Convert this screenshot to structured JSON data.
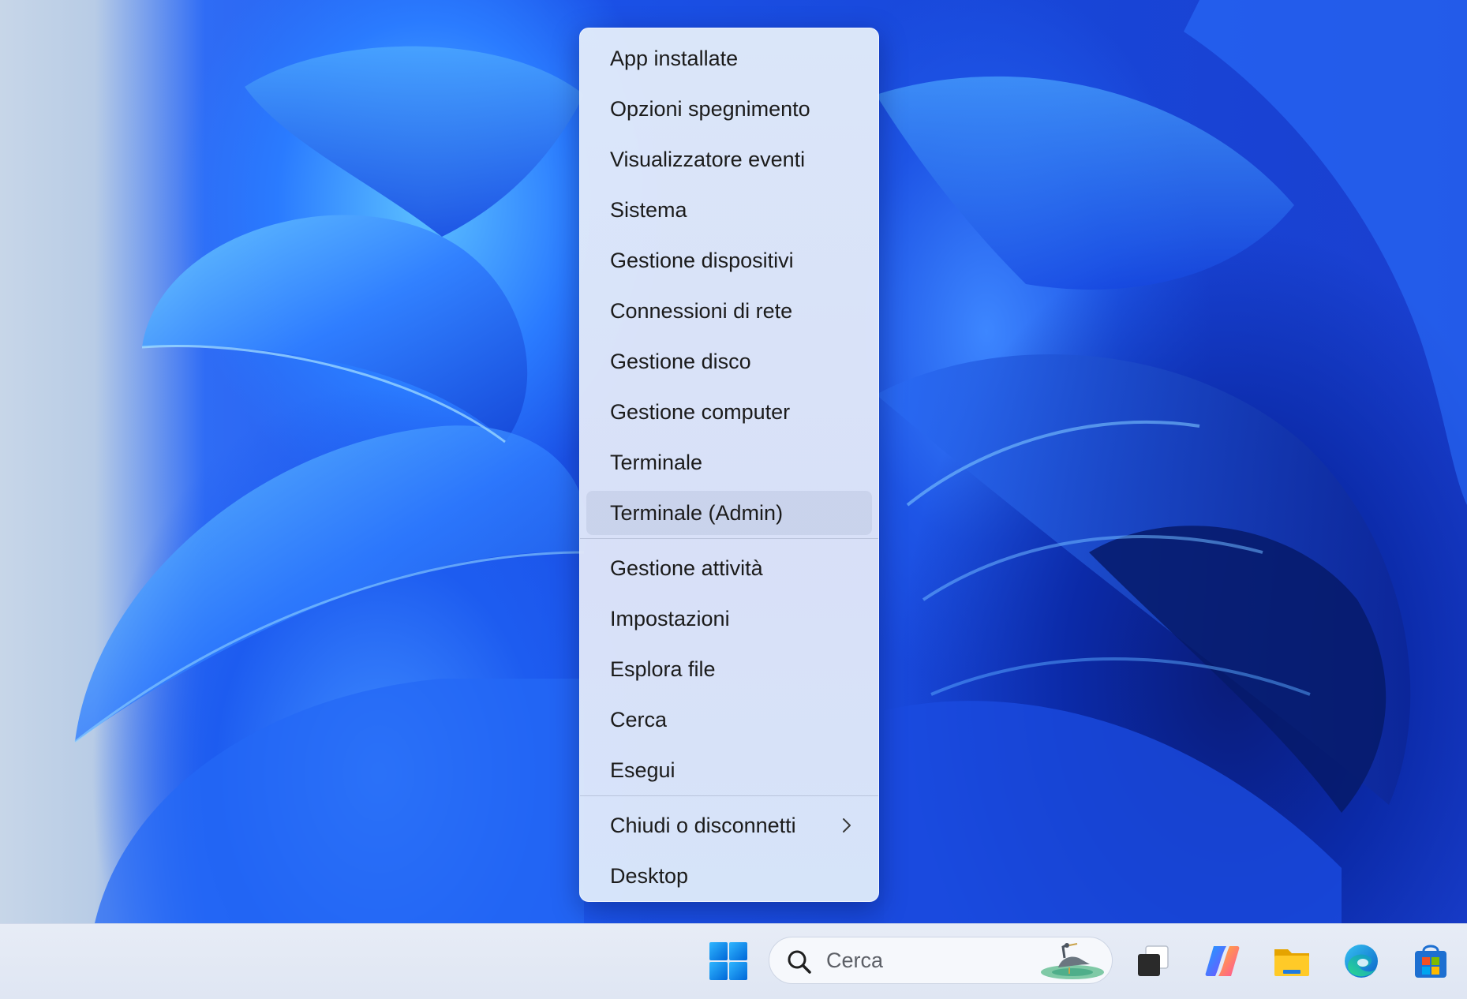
{
  "menu": {
    "items": [
      {
        "label": "App installate"
      },
      {
        "label": "Opzioni spegnimento"
      },
      {
        "label": "Visualizzatore eventi"
      },
      {
        "label": "Sistema"
      },
      {
        "label": "Gestione dispositivi"
      },
      {
        "label": "Connessioni di rete"
      },
      {
        "label": "Gestione disco"
      },
      {
        "label": "Gestione computer"
      },
      {
        "label": "Terminale"
      },
      {
        "label": "Terminale (Admin)"
      },
      {
        "label": "Gestione attività"
      },
      {
        "label": "Impostazioni"
      },
      {
        "label": "Esplora file"
      },
      {
        "label": "Cerca"
      },
      {
        "label": "Esegui"
      },
      {
        "label": "Chiudi o disconnetti"
      },
      {
        "label": "Desktop"
      }
    ],
    "hovered_item": "Terminale (Admin)",
    "submenu_item": "Chiudi o disconnetti"
  },
  "taskbar": {
    "search": {
      "placeholder": "Cerca"
    },
    "icons": [
      "windows-start-icon",
      "search-icon",
      "heron-widget-icon",
      "task-view-icon",
      "copilot-icon",
      "file-explorer-icon",
      "edge-icon",
      "store-icon"
    ]
  },
  "colors": {
    "accent": "#0078d4",
    "menu_bg": "#e2ecfa",
    "taskbar_bg": "#e4e9f4"
  }
}
